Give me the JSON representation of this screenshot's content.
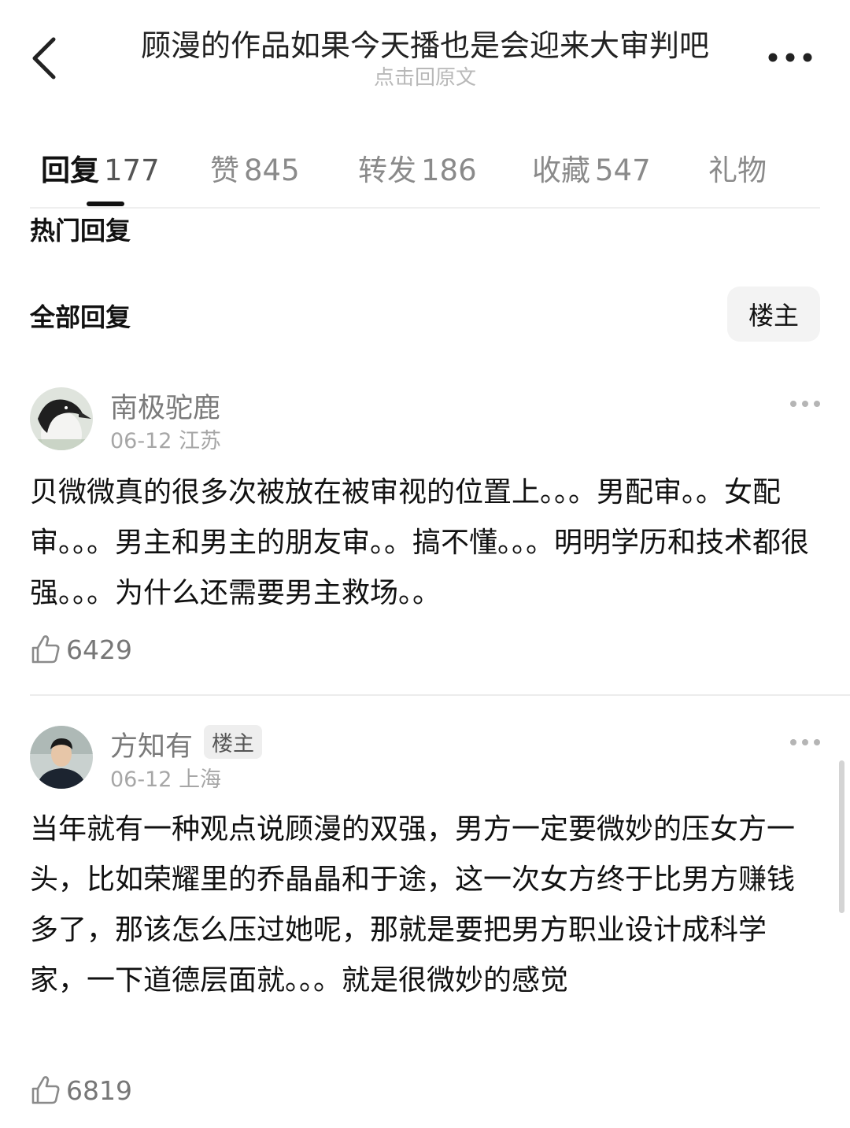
{
  "header": {
    "title": "顾漫的作品如果今天播也是会迎来大审判吧",
    "subtitle": "点击回原文",
    "back_icon": "chevron-left-icon",
    "more_icon": "more-horizontal-icon"
  },
  "tabs": [
    {
      "label": "回复",
      "count": "177",
      "active": true
    },
    {
      "label": "赞",
      "count": "845",
      "active": false
    },
    {
      "label": "转发",
      "count": "186",
      "active": false
    },
    {
      "label": "收藏",
      "count": "547",
      "active": false
    },
    {
      "label": "礼物",
      "count": "",
      "active": false
    }
  ],
  "sections": {
    "hot_replies": "热门回复",
    "all_replies": "全部回复",
    "filter_button": "楼主"
  },
  "comments": [
    {
      "username": "南极驼鹿",
      "badge": "",
      "date": "06-12",
      "location": "江苏",
      "text": "贝微微真的很多次被放在被审视的位置上。。。男配审。。女配审。。。男主和男主的朋友审。。搞不懂。。。明明学历和技术都很强。。。为什么还需要男主救场。。",
      "likes": "6429"
    },
    {
      "username": "方知有",
      "badge": "楼主",
      "date": "06-12",
      "location": "上海",
      "text": "当年就有一种观点说顾漫的双强，男方一定要微妙的压女方一头，比如荣耀里的乔晶晶和于途，这一次女方终于比男方赚钱多了，那该怎么压过她呢，那就是要把男方职业设计成科学家，一下道德层面就。。。就是很微妙的感觉",
      "likes": "6819"
    }
  ],
  "colors": {
    "text": "#111111",
    "muted": "#8a8a8a",
    "divider": "#ececec",
    "badge_bg": "#eeeeee"
  }
}
